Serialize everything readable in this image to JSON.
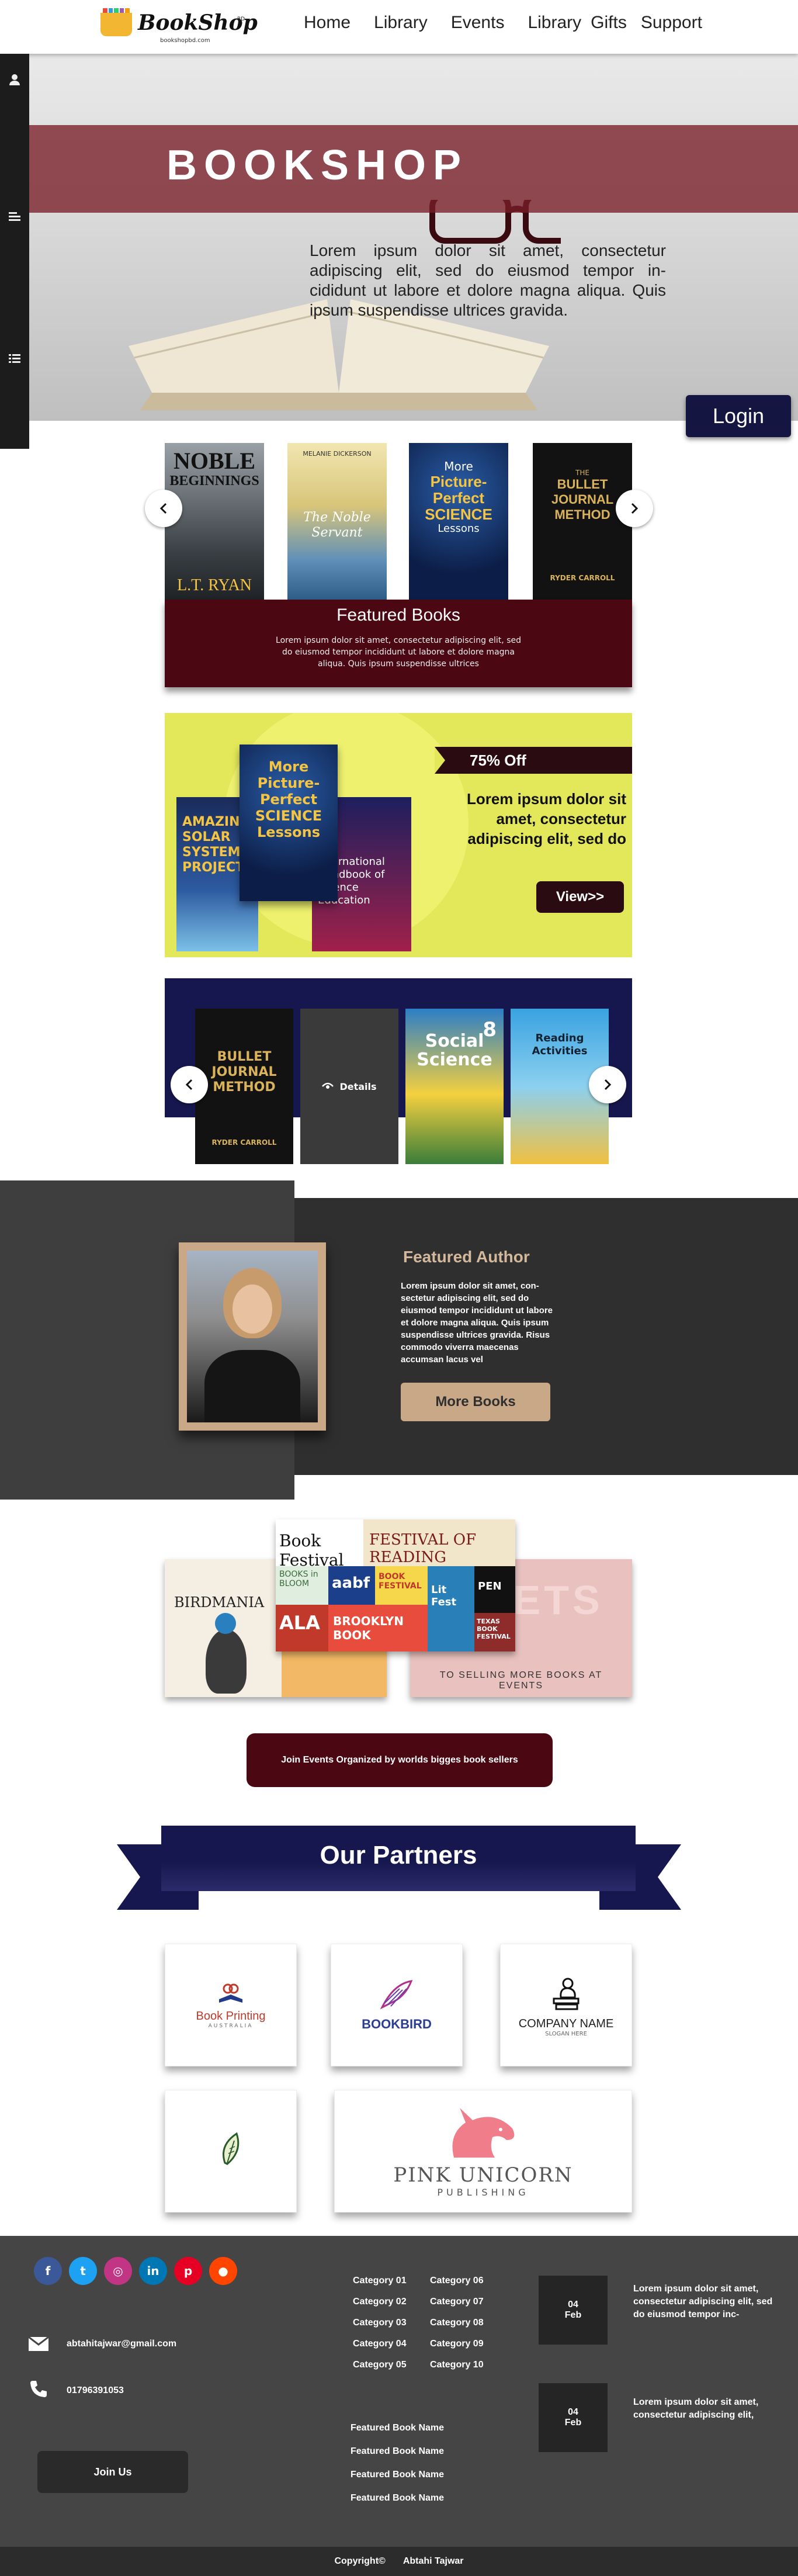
{
  "brand": {
    "name": "BookShop",
    "tagline": "bookshopbd.com",
    "mark": "BD"
  },
  "nav": {
    "items": [
      {
        "label": "Home"
      },
      {
        "label": "Library"
      },
      {
        "label": "Events"
      },
      {
        "label": "Library"
      },
      {
        "label": "Gifts"
      },
      {
        "label": "Support"
      }
    ]
  },
  "sidebar": {
    "icons": [
      "user-icon",
      "menu-icon",
      "list-icon"
    ]
  },
  "hero": {
    "title": "BOOKSHOP",
    "text": "Lorem ipsum dolor sit amet, consectetur adipiscing elit, sed do eiusmod tempor in-cididunt ut labore et dolore magna aliqua. Quis ipsum suspendisse ultrices gravida.",
    "login_label": "Login"
  },
  "featured_books": {
    "title": "Featured Books",
    "text": "Lorem ipsum dolor sit amet, consectetur adipiscing elit, sed do eiusmod tempor incididunt ut labore et dolore magna aliqua. Quis ipsum suspendisse ultrices",
    "covers": [
      {
        "line1": "NOBLE",
        "line2": "BEGINNINGS",
        "author": "L.T. RYAN"
      },
      {
        "line1": "MELANIE DICKERSON",
        "line2": "The Noble Servant",
        "author": ""
      },
      {
        "line1": "More",
        "line2": "Picture-Perfect SCIENCE",
        "author": "Lessons"
      },
      {
        "line1": "THE",
        "line2": "BULLET JOURNAL METHOD",
        "author": "RYDER CARROLL"
      }
    ]
  },
  "offer": {
    "ribbon": "75% Off",
    "text": "Lorem ipsum dolor sit amet, consectetur adipiscing elit, sed do",
    "view_label": "View>>",
    "book_titles": {
      "science": "More Picture-Perfect SCIENCE Lessons",
      "handbook": "International Handbook of Science Education",
      "solar": "AMAZING SOLAR SYSTEM PROJECTS"
    }
  },
  "carousel2": {
    "details_label": "Details",
    "covers": [
      {
        "title": "BULLET JOURNAL METHOD",
        "author": "RYDER CARROLL"
      },
      {
        "title": "Social Science",
        "author": "8"
      },
      {
        "title": "Reading Activities",
        "author": ""
      }
    ]
  },
  "author": {
    "title": "Featured Author",
    "text": "Lorem ipsum dolor sit amet, con-sectetur adipiscing elit, sed do eiusmod tempor incididunt ut labore et dolore magna aliqua. Quis ipsum suspendisse ultrices gravida. Risus commodo viverra maecenas accumsan lacus vel",
    "button_label": "More Books"
  },
  "events": {
    "left_title": "BIRDMANIA",
    "right_text": "TO SELLING MORE BOOKS AT EVENTS",
    "center_labels": [
      "Book Festival",
      "FESTIVAL OF READING",
      "BOOKS in BLOOM",
      "ALA",
      "aabf",
      "BOOK FESTIVAL",
      "BROOKLYN BOOK",
      "Lit Fest",
      "PEN",
      "TEXAS BOOK FESTIVAL"
    ],
    "button_label": "Join Events Organized by worlds bigges book sellers"
  },
  "partners": {
    "title": "Our Partners",
    "cards": [
      {
        "name": "Book Printing",
        "sub": "AUSTRALIA"
      },
      {
        "name": "BOOKBIRD",
        "sub": ""
      },
      {
        "name": "COMPANY NAME",
        "sub": "SLOGAN HERE"
      },
      {
        "name": "",
        "sub": ""
      },
      {
        "name": "PINK UNICORN",
        "sub": "PUBLISHING"
      }
    ]
  },
  "footer": {
    "social": [
      {
        "icon": "facebook-icon",
        "glyph": "f",
        "color": "#3b5998"
      },
      {
        "icon": "twitter-icon",
        "glyph": "t",
        "color": "#1da1f2"
      },
      {
        "icon": "instagram-icon",
        "glyph": "◎",
        "color": "#c13584"
      },
      {
        "icon": "linkedin-icon",
        "glyph": "in",
        "color": "#0077b5"
      },
      {
        "icon": "pinterest-icon",
        "glyph": "p",
        "color": "#e60023"
      },
      {
        "icon": "reddit-icon",
        "glyph": "●",
        "color": "#ff4500"
      }
    ],
    "email": "abtahitajwar@gmail.com",
    "phone": "01796391053",
    "join_label": "Join Us",
    "categories_left": [
      "Category 01",
      "Category 02",
      "Category 03",
      "Category 04",
      "Category 05"
    ],
    "categories_right": [
      "Category 06",
      "Category 07",
      "Category 08",
      "Category 09",
      "Category 10"
    ],
    "featured_names": [
      "Featured Book Name",
      "Featured Book Name",
      "Featured Book Name",
      "Featured Book Name"
    ],
    "news": [
      {
        "day": "04",
        "month": "Feb",
        "text": "Lorem ipsum dolor sit amet, consectetur adipiscing elit, sed do eiusmod tempor inc-"
      },
      {
        "day": "04",
        "month": "Feb",
        "text": "Lorem ipsum dolor sit amet, consectetur adipiscing elit,"
      }
    ],
    "copyright": "Copyright©",
    "copyright_name": "Abtahi Tajwar"
  }
}
